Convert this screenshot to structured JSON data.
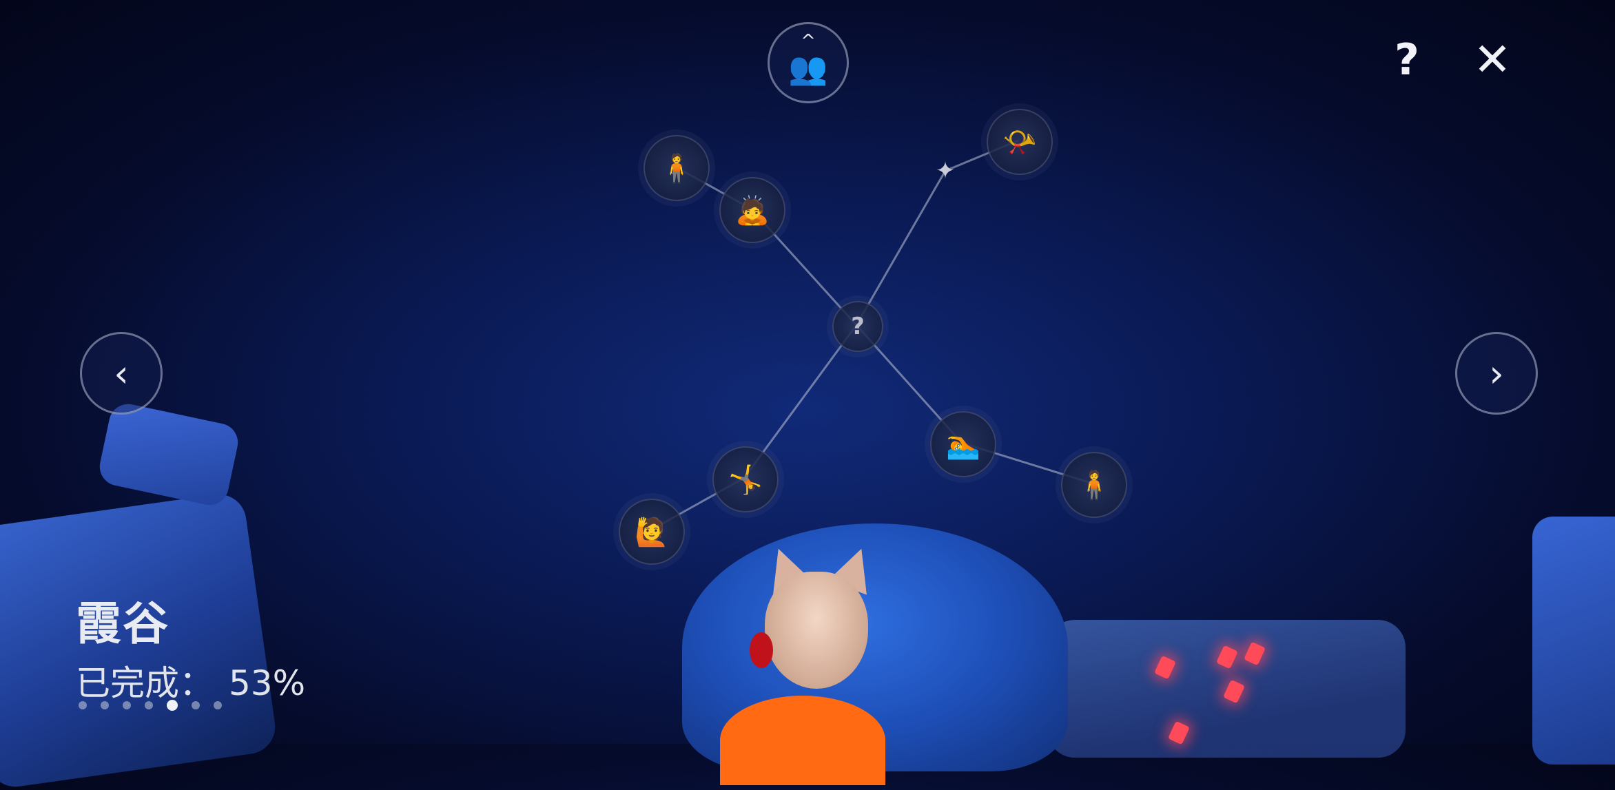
{
  "realm": {
    "name": "霞谷",
    "progress_label": "已完成：",
    "progress_value": "53%",
    "progress_fraction": 0.53
  },
  "pagination": {
    "count": 7,
    "active_index": 4
  },
  "top_bar": {
    "friends_icon": "friends-icon",
    "help_label": "?",
    "close_label": "✕"
  },
  "nav": {
    "prev_label": "‹",
    "next_label": "›"
  },
  "constellation": {
    "center_label": "?",
    "nodes": [
      {
        "id": "spirit-stand",
        "icon": "person-standing-icon",
        "glyph": "🧍"
      },
      {
        "id": "spirit-bow",
        "icon": "person-bow-icon",
        "glyph": "🙇"
      },
      {
        "id": "spirit-center",
        "icon": "question-icon",
        "glyph": "?"
      },
      {
        "id": "spirit-whistle",
        "icon": "whistle-icon",
        "glyph": "📯"
      },
      {
        "id": "spirit-cartwheel",
        "icon": "cartwheel-icon",
        "glyph": "🤸"
      },
      {
        "id": "spirit-wave",
        "icon": "person-wave-icon",
        "glyph": "🙋"
      },
      {
        "id": "spirit-dive",
        "icon": "dive-icon",
        "glyph": "🏊"
      },
      {
        "id": "spirit-arms-crossed",
        "icon": "arms-crossed-icon",
        "glyph": "🧍"
      }
    ],
    "star_glyph": "✦"
  }
}
